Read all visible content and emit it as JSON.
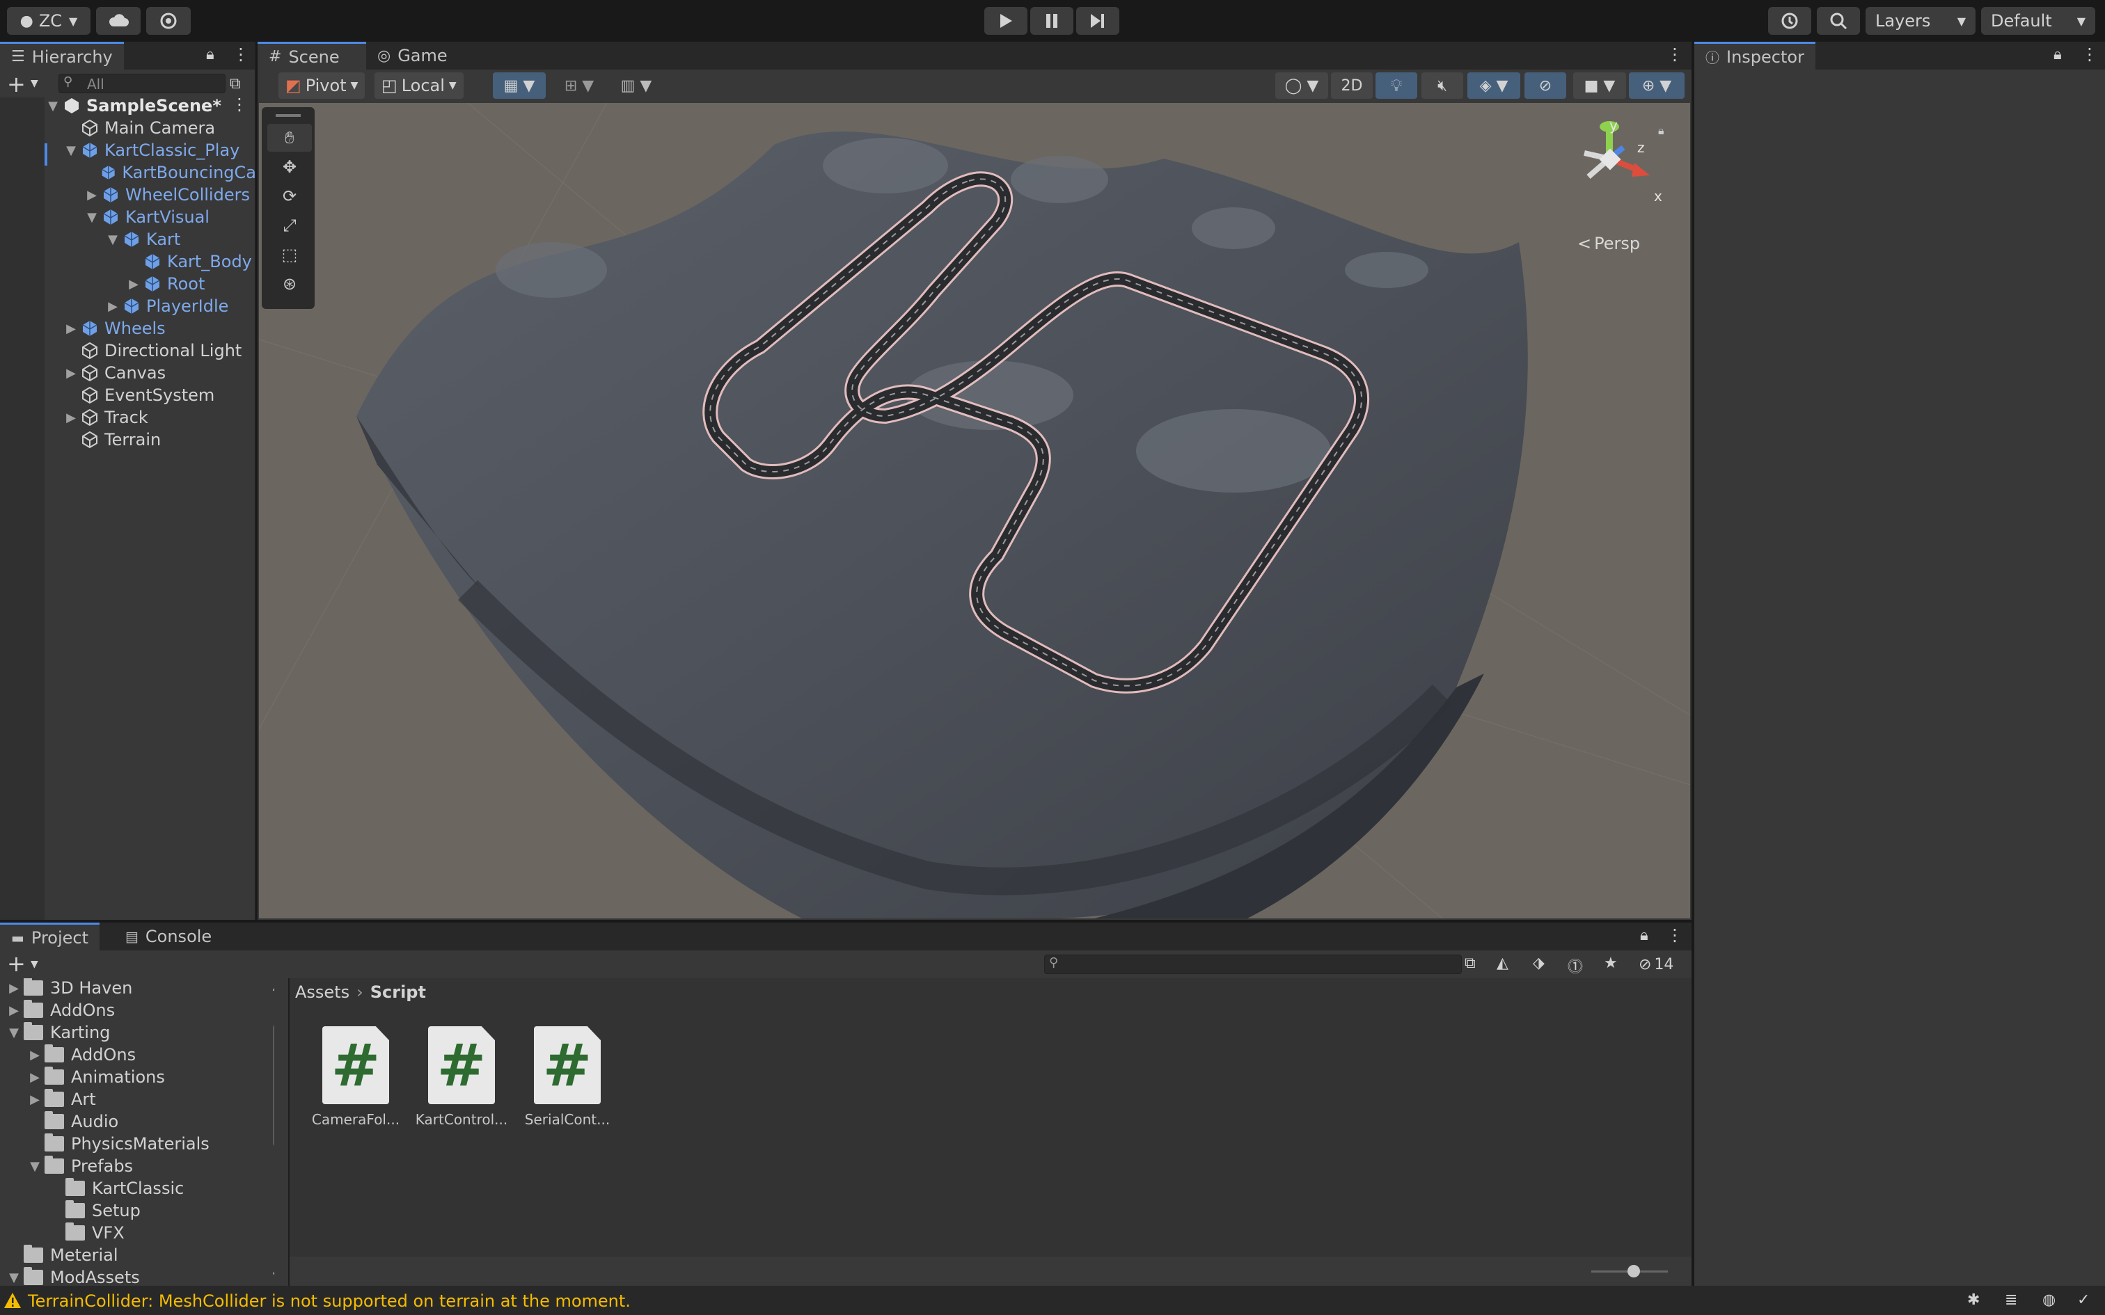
{
  "toolbar": {
    "account": "ZC",
    "layers": "Layers",
    "layout": "Default"
  },
  "hierarchy": {
    "tab": "Hierarchy",
    "search_placeholder": "All",
    "scene": "SampleScene*",
    "items": [
      {
        "label": "Main Camera",
        "blue": false
      },
      {
        "label": "KartClassic_Play",
        "blue": true
      },
      {
        "label": "KartBouncingCa",
        "blue": true
      },
      {
        "label": "WheelColliders",
        "blue": true
      },
      {
        "label": "KartVisual",
        "blue": true
      },
      {
        "label": "Kart",
        "blue": true
      },
      {
        "label": "Kart_Body",
        "blue": true
      },
      {
        "label": "Root",
        "blue": true
      },
      {
        "label": "PlayerIdle",
        "blue": true
      },
      {
        "label": "Wheels",
        "blue": true
      },
      {
        "label": "Directional Light",
        "blue": false
      },
      {
        "label": "Canvas",
        "blue": false
      },
      {
        "label": "EventSystem",
        "blue": false
      },
      {
        "label": "Track",
        "blue": false
      },
      {
        "label": "Terrain",
        "blue": false
      }
    ]
  },
  "scene_view": {
    "tabs": [
      "Scene",
      "Game"
    ],
    "pivot": "Pivot",
    "local": "Local",
    "mode_2d": "2D",
    "persp": "Persp",
    "gizmo_y": "y",
    "gizmo_z": "z",
    "gizmo_x": "x"
  },
  "inspector": {
    "tab": "Inspector"
  },
  "project": {
    "tabs": [
      "Project",
      "Console"
    ],
    "hidden_count": "14",
    "breadcrumb": [
      "Assets",
      "Script"
    ],
    "tree": [
      {
        "label": "3D Haven"
      },
      {
        "label": "AddOns"
      },
      {
        "label": "Karting"
      },
      {
        "label": "AddOns"
      },
      {
        "label": "Animations"
      },
      {
        "label": "Art"
      },
      {
        "label": "Audio"
      },
      {
        "label": "PhysicsMaterials"
      },
      {
        "label": "Prefabs"
      },
      {
        "label": "KartClassic"
      },
      {
        "label": "Setup"
      },
      {
        "label": "VFX"
      },
      {
        "label": "Meterial"
      },
      {
        "label": "ModAssets"
      }
    ],
    "assets": [
      {
        "name": "CameraFol...",
        "glyph": "#"
      },
      {
        "name": "KartControl...",
        "glyph": "#"
      },
      {
        "name": "SerialCont...",
        "glyph": "#"
      }
    ]
  },
  "status": {
    "message": "TerrainCollider: MeshCollider is not supported on terrain at the moment.",
    "warning_color": "#f4bc02"
  }
}
